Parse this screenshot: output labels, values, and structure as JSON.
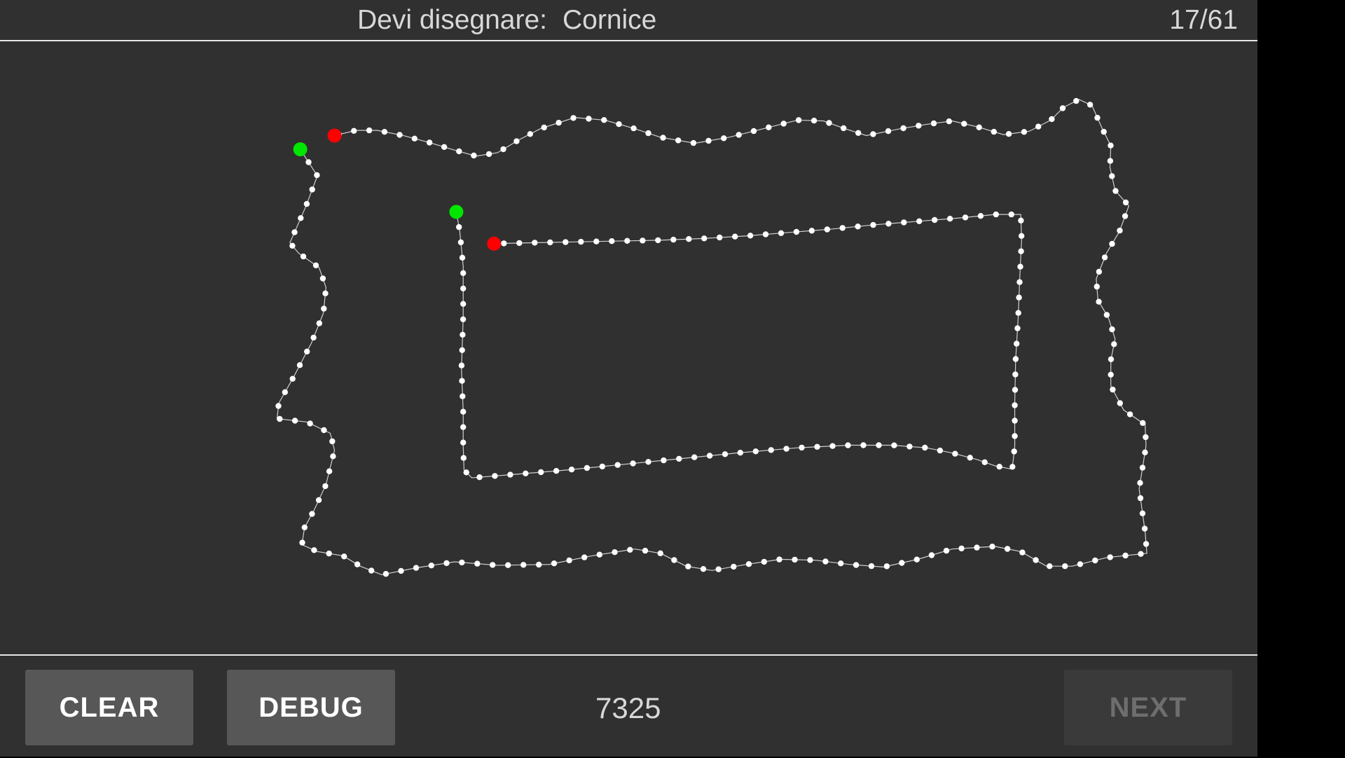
{
  "header": {
    "prompt_label": "Devi disegnare:",
    "target_word": "Cornice",
    "progress": "17/61"
  },
  "footer": {
    "clear_label": "CLEAR",
    "debug_label": "DEBUG",
    "score": "7325",
    "next_label": "NEXT",
    "next_enabled": false
  },
  "colors": {
    "background": "#303030",
    "stroke": "#ffffff",
    "start_point": "#00e600",
    "end_point": "#ff0000",
    "button": "#575757",
    "button_disabled": "#3a3a3a"
  }
}
